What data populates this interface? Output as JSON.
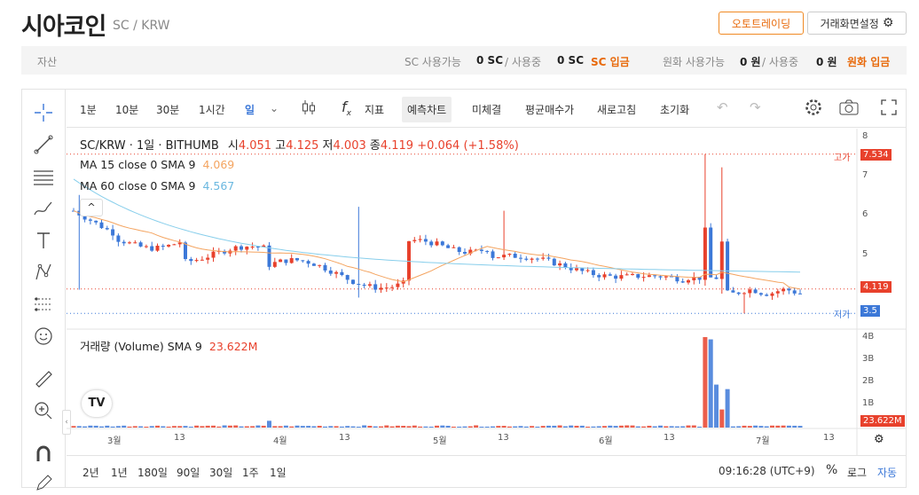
{
  "header": {
    "coin_name": "시아코인",
    "pair": "SC / KRW",
    "auto_trading": "오토트레이딩",
    "screen_settings": "거래화면설정"
  },
  "assets": {
    "label": "자산",
    "sc_available_label": "SC 사용가능",
    "sc_available_value": "0",
    "sc_unit": "SC",
    "sc_in_use_label": "사용중",
    "sc_in_use_value": "0",
    "sc_deposit": "SC 입금",
    "krw_available_label": "원화 사용가능",
    "krw_available_value": "0",
    "krw_unit": "원",
    "krw_in_use_label": "사용중",
    "krw_in_use_value": "0",
    "krw_deposit": "원화 입금"
  },
  "toolbar": {
    "intervals": [
      "1분",
      "10분",
      "30분",
      "1시간",
      "일"
    ],
    "indicator_label": "지표",
    "predict_chart": "예측차트",
    "unfilled": "미체결",
    "avg_price": "평균매수가",
    "refresh": "새로고침",
    "reset": "초기화"
  },
  "legend": {
    "symbol": "SC/KRW · 1일 · BITHUMB",
    "o_label": "시",
    "o": "4.051",
    "h_label": "고",
    "h": "4.125",
    "l_label": "저",
    "l": "4.003",
    "c_label": "종",
    "c": "4.119",
    "change": "+0.064 (+1.58%)",
    "ma15_label": "MA 15 close 0 SMA 9",
    "ma15_value": "4.069",
    "ma60_label": "MA 60 close 0 SMA 9",
    "ma60_value": "4.567",
    "volume_label": "거래량 (Volume) SMA 9",
    "volume_value": "23.622M"
  },
  "price_axis": {
    "ticks": [
      "8",
      "7",
      "6",
      "5"
    ],
    "high_label": "고가",
    "high_value": "7.534",
    "last_value": "4.119",
    "low_label": "저가",
    "low_value": "3.5"
  },
  "volume_axis": {
    "ticks": [
      "4B",
      "3B",
      "2B",
      "1B"
    ],
    "last_value": "23.622M"
  },
  "time_axis": [
    "3월",
    "13",
    "4월",
    "13",
    "5월",
    "13",
    "6월",
    "13",
    "7월",
    "13"
  ],
  "bottom_bar": {
    "ranges": [
      "2년",
      "1년",
      "180일",
      "90일",
      "30일",
      "1주",
      "1일"
    ],
    "clock": "09:16:28 (UTC+9)",
    "percent": "%",
    "log": "로그",
    "auto": "자동"
  },
  "colors": {
    "up": "#e8412c",
    "down": "#3c78d8",
    "accent": "#e8690a",
    "ma15": "#f4a460",
    "ma60": "#87ceeb"
  }
}
